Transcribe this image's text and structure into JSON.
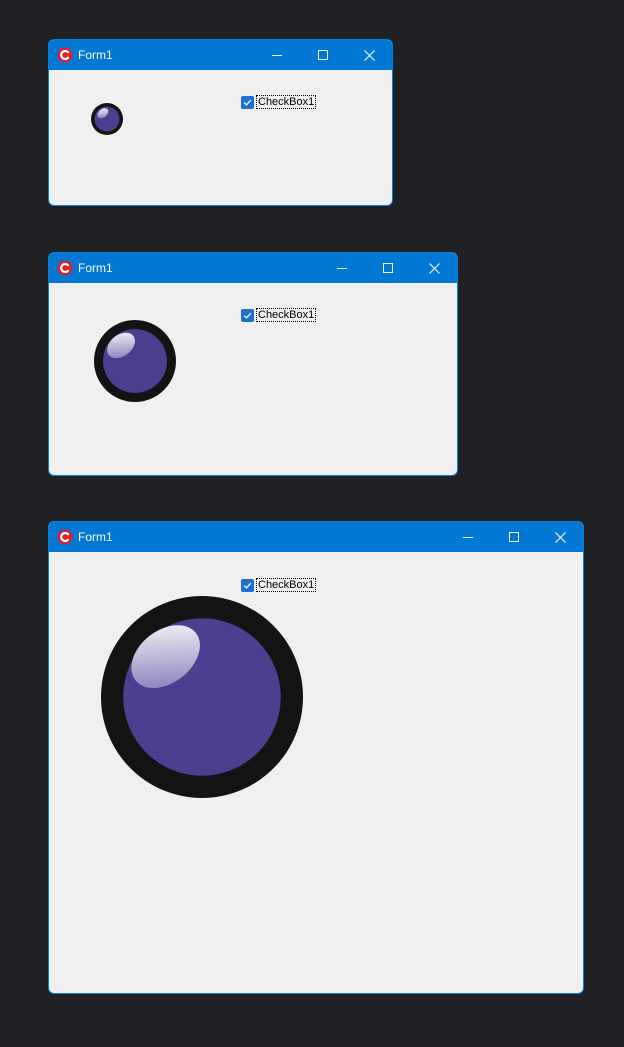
{
  "windows": [
    {
      "title": "Form1",
      "checkbox": {
        "label": "CheckBox1",
        "checked": true
      }
    },
    {
      "title": "Form1",
      "checkbox": {
        "label": "CheckBox1",
        "checked": true
      }
    },
    {
      "title": "Form1",
      "checkbox": {
        "label": "CheckBox1",
        "checked": true
      }
    }
  ],
  "colors": {
    "desktop": "#202124",
    "titlebar": "#0078d4",
    "client": "#f0f0f0",
    "orb_fill": "#4b3f8f",
    "orb_ring": "#131313",
    "checkbox": "#1f6fd0",
    "app_icon": "#e0202a"
  },
  "icons": {
    "app": "app-logo-icon",
    "minimize": "minimize-icon",
    "maximize": "maximize-icon",
    "close": "close-icon",
    "check": "checkmark-icon"
  }
}
